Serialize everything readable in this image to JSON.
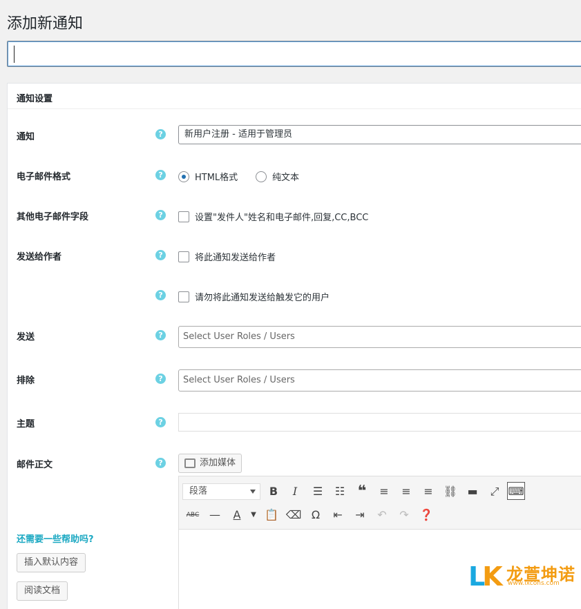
{
  "page": {
    "title": "添加新通知"
  },
  "panel": {
    "title": "通知设置"
  },
  "rows": {
    "notification": {
      "label": "通知",
      "value": "新用户注册 - 适用于管理员"
    },
    "email_format": {
      "label": "电子邮件格式",
      "options": [
        "HTML格式",
        "纯文本"
      ],
      "selected": "HTML格式"
    },
    "other_fields": {
      "label": "其他电子邮件字段",
      "checkbox": "设置\"发件人\"姓名和电子邮件,回复,CC,BCC"
    },
    "send_author": {
      "label": "发送给作者",
      "checkbox1": "将此通知发送给作者",
      "checkbox2": "请勿将此通知发送给触发它的用户"
    },
    "send": {
      "label": "发送",
      "placeholder": "Select User Roles / Users"
    },
    "exclude": {
      "label": "排除",
      "placeholder": "Select User Roles / Users"
    },
    "subject": {
      "label": "主题"
    },
    "body": {
      "label": "邮件正文"
    }
  },
  "editor": {
    "add_media": "添加媒体",
    "format_select": "段落"
  },
  "sidebar": {
    "help_link": "还需要一些帮助吗?",
    "insert_default": "插入默认内容",
    "read_docs": "阅读文档"
  },
  "help_icon": "?",
  "watermark": {
    "brand": "龙萱坤诺",
    "url": "www.lxcons.com"
  },
  "colors": {
    "help_icon": "#6cd1e3",
    "link": "#1aa8c2"
  }
}
